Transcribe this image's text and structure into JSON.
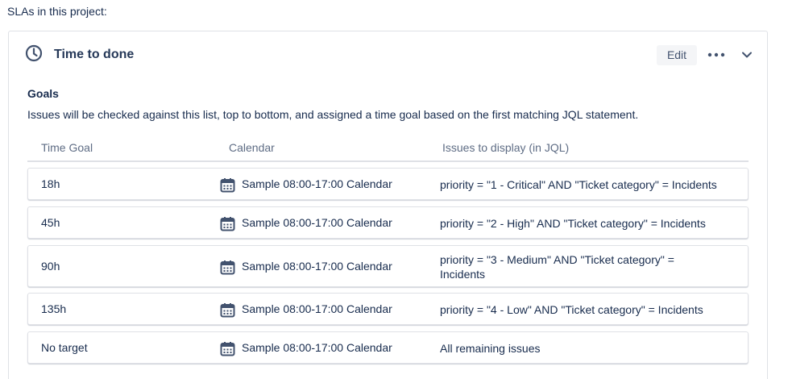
{
  "page": {
    "section_label": "SLAs in this project:"
  },
  "sla": {
    "title": "Time to done",
    "edit_label": "Edit",
    "goals_heading": "Goals",
    "goals_description": "Issues will be checked against this list, top to bottom, and assigned a time goal based on the first matching JQL statement."
  },
  "table": {
    "headers": {
      "time_goal": "Time Goal",
      "calendar": "Calendar",
      "issues": "Issues to display (in JQL)"
    },
    "rows": [
      {
        "goal": "18h",
        "calendar": "Sample 08:00-17:00 Calendar",
        "jql": "priority = \"1 - Critical\" AND \"Ticket category\" = Incidents"
      },
      {
        "goal": "45h",
        "calendar": "Sample 08:00-17:00 Calendar",
        "jql": "priority = \"2 - High\" AND \"Ticket category\" = Incidents"
      },
      {
        "goal": "90h",
        "calendar": "Sample 08:00-17:00 Calendar",
        "jql": "priority = \"3 - Medium\" AND \"Ticket category\" = Incidents"
      },
      {
        "goal": "135h",
        "calendar": "Sample 08:00-17:00 Calendar",
        "jql": "priority = \"4 - Low\" AND \"Ticket category\" = Incidents"
      },
      {
        "goal": "No target",
        "calendar": "Sample 08:00-17:00 Calendar",
        "jql": "All remaining issues"
      }
    ]
  },
  "icons": {
    "clock": "clock-icon",
    "more": "more-icon",
    "chevron": "chevron-down-icon",
    "calendar": "calendar-icon"
  },
  "colors": {
    "text": "#172b4d",
    "muted": "#5e6c84",
    "border": "#dfe1e6",
    "button_bg": "#f4f5f7",
    "icon": "#42526e"
  }
}
